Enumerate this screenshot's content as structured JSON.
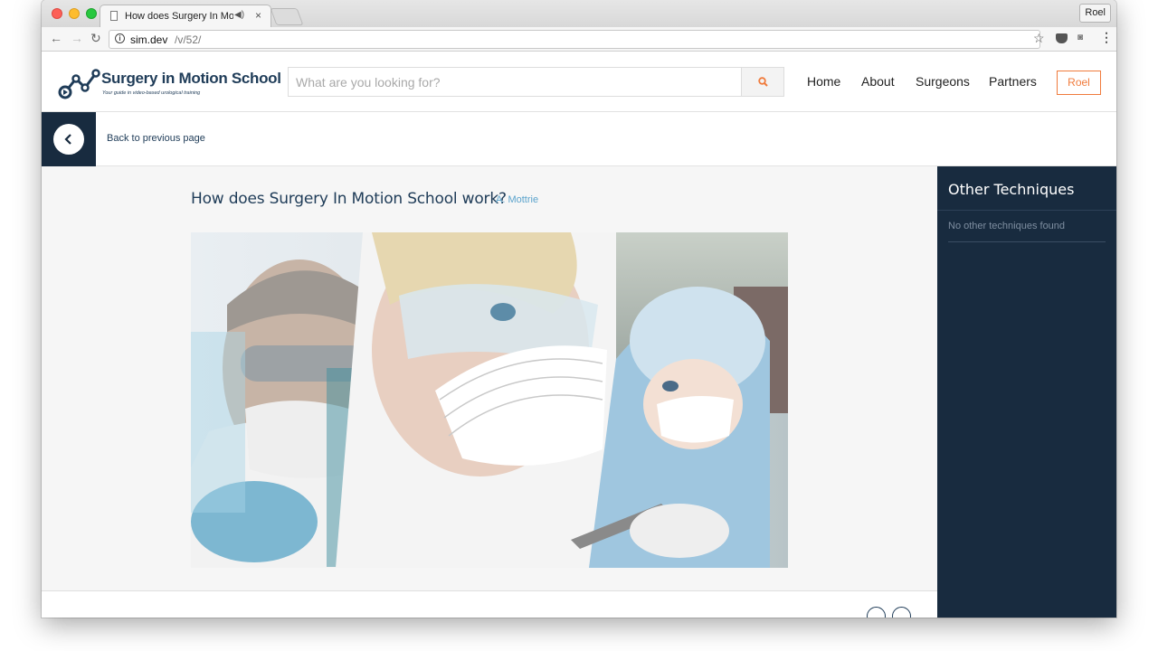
{
  "browser": {
    "tab_title": "How does Surgery In Motion School work?",
    "tab_title_visible": "How does Surgery In Motio",
    "profile_name": "Roel",
    "url_host": "sim.dev",
    "url_path": "/v/52/"
  },
  "site": {
    "logo_name": "Surgery in Motion School",
    "logo_tagline": "Your guide in video-based urological training",
    "search_placeholder": "What are you looking for?",
    "nav": [
      {
        "label": "Home"
      },
      {
        "label": "About"
      },
      {
        "label": "Surgeons"
      },
      {
        "label": "Partners"
      }
    ],
    "user_label": "Roel",
    "accent_color": "#f07b3c",
    "brand_color": "#182b3f"
  },
  "back": {
    "label": "Back to previous page"
  },
  "video": {
    "title": "How does Surgery In Motion School work?",
    "author": "A. Mottrie",
    "image_subject": "surgeons-in-operating-room"
  },
  "sidebar": {
    "title": "Other Techniques",
    "empty_text": "No other techniques found"
  }
}
